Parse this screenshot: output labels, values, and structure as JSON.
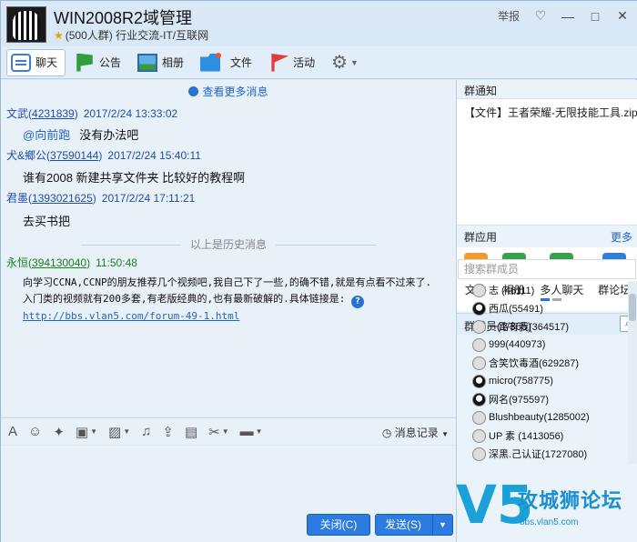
{
  "window": {
    "title": "WIN2008R2域管理",
    "subtitle": "(500人群) 行业交流-IT/互联网",
    "report_label": "举报",
    "colors": {
      "accent": "#2c7be0",
      "link": "#2466c4",
      "green_name": "#1d7f1d"
    }
  },
  "tabs": [
    {
      "label": "聊天",
      "icon": "chat-bubble-icon"
    },
    {
      "label": "公告",
      "icon": "flag-icon"
    },
    {
      "label": "相册",
      "icon": "photo-icon"
    },
    {
      "label": "文件",
      "icon": "folder-icon"
    },
    {
      "label": "活动",
      "icon": "event-flag-icon"
    }
  ],
  "chat": {
    "more_messages": "查看更多消息",
    "history_divider": "以上是历史消息",
    "messages": [
      {
        "name": "文武",
        "qq": "4231839",
        "time": "2017/2/24 13:33:02",
        "at": "@向前跑",
        "text": "没有办法吧"
      },
      {
        "name": "犬&鄉公",
        "qq": "37590144",
        "time": "2017/2/24 15:40:11",
        "text": "谁有2008 新建共享文件夹 比较好的教程啊"
      },
      {
        "name": "君墨",
        "qq": "1393021625",
        "time": "2017/2/24 17:11:21",
        "text": "去买书把"
      },
      {
        "name": "永恒",
        "qq": "394130040",
        "time": "11:50:48",
        "line1": "向学习CCNA,CCNP的朋友推荐几个视频吧,我自己下了一些,的确不错,就是有点看不过来了.",
        "line2": "入门类的视频就有200多套,有老版经典的,也有最新破解的.具体链接是:",
        "link": "http://bbs.vlan5.com/forum-49-1.html"
      }
    ]
  },
  "input": {
    "record_label": "消息记录",
    "close_label": "关闭(C)",
    "send_label": "发送(S)"
  },
  "right": {
    "notice_title": "群通知",
    "notice_text": "【文件】王者荣耀-无限技能工具.zip",
    "apps_title": "群应用",
    "apps_more": "更多",
    "apps": [
      {
        "label": "文件",
        "icon": "folder-icon"
      },
      {
        "label": "相册",
        "icon": "photo-icon"
      },
      {
        "label": "多人聊天",
        "icon": "group-chat-icon"
      },
      {
        "label": "群论坛",
        "icon": "forum-icon"
      }
    ],
    "members_title": "群成员(1/365)",
    "members_search_placeholder": "搜索群成员",
    "members": [
      {
        "name": "志  (46111)"
      },
      {
        "name": "西瓜(55491)"
      },
      {
        "name": "一路有我(364517)"
      },
      {
        "name": "999(440973)"
      },
      {
        "name": "含笑饮毒酒(629287)"
      },
      {
        "name": "micro(758775)"
      },
      {
        "name": "网名(975597)"
      },
      {
        "name": "Blushbeauty(1285002)"
      },
      {
        "name": "UP  素  (1413056)"
      },
      {
        "name": "深黑.己认证(1727080)"
      }
    ]
  },
  "watermark": {
    "big": "V5",
    "text": "攻城狮论坛",
    "url": "bbs.vlan5.com"
  }
}
